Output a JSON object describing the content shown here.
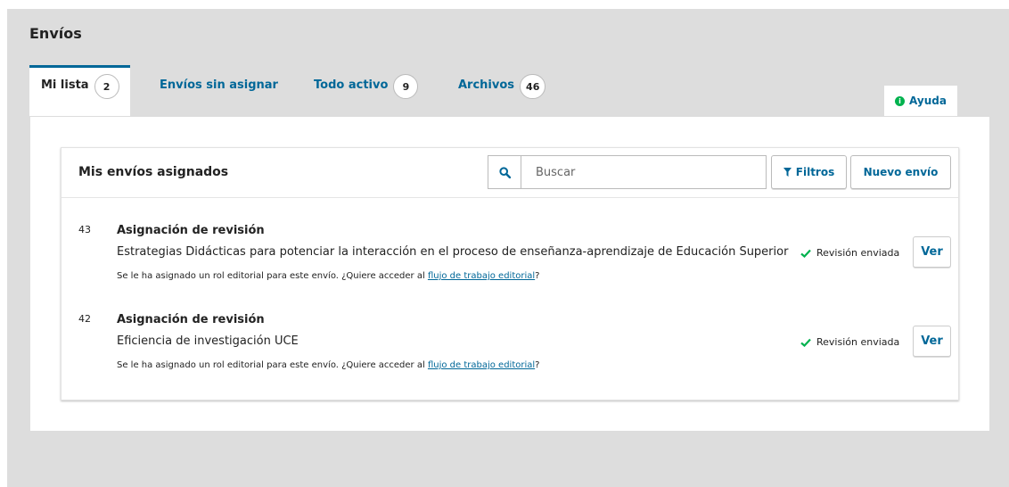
{
  "page": {
    "title": "Envíos"
  },
  "tabs": [
    {
      "label": "Mi lista",
      "count": "2"
    },
    {
      "label": "Envíos sin asignar",
      "count": ""
    },
    {
      "label": "Todo activo",
      "count": "9"
    },
    {
      "label": "Archivos",
      "count": "46"
    }
  ],
  "help": {
    "label": "Ayuda",
    "icon": "info-icon"
  },
  "list": {
    "title": "Mis envíos asignados",
    "search_placeholder": "Buscar",
    "filters_label": "Filtros",
    "new_label": "Nuevo envío",
    "items": [
      {
        "id": "43",
        "type": "Asignación de revisión",
        "title": "Estrategias Didácticas para potenciar la interacción en el proceso de enseñanza-aprendizaje de Educación Superior",
        "note_prefix": "Se le ha asignado un rol editorial para este envío. ¿Quiere acceder al ",
        "note_link": "flujo de trabajo editorial",
        "note_suffix": "?",
        "status": "Revisión enviada",
        "view_label": "Ver"
      },
      {
        "id": "42",
        "type": "Asignación de revisión",
        "title": "Eficiencia de investigación UCE",
        "note_prefix": "Se le ha asignado un rol editorial para este envío. ¿Quiere acceder al ",
        "note_link": "flujo de trabajo editorial",
        "note_suffix": "?",
        "status": "Revisión enviada",
        "view_label": "Ver"
      }
    ]
  },
  "colors": {
    "accent": "#006798",
    "success": "#00b24e",
    "background": "#dddddd"
  }
}
